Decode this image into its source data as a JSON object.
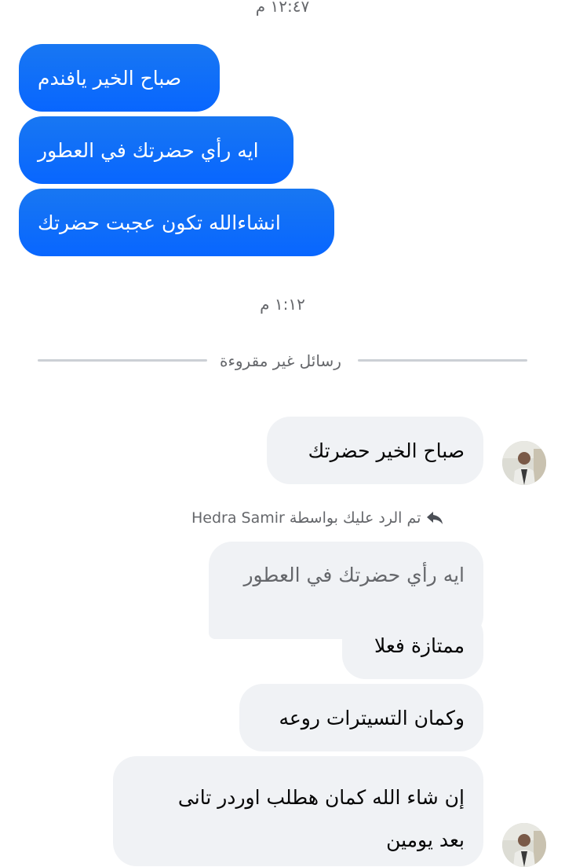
{
  "timestamps": {
    "first": "١٢:٤٧ م",
    "second": "١:١٢ م"
  },
  "outgoing": [
    "صباح الخير يافندم",
    "ايه رأي حضرتك في العطور",
    "انشاءالله تكون عجبت حضرتك"
  ],
  "unread_divider": "رسائل غير مقروءة",
  "incoming_first": "صباح الخير حضرتك",
  "reply_notice": "تم الرد عليك بواسطة Hedra Samir",
  "quoted_message": "ايه رأي حضرتك في العطور",
  "incoming": [
    "ممتازة فعلا",
    "وكمان التسيترات روعه"
  ],
  "incoming_last": {
    "line1": "إن شاء الله كمان هطلب اوردر تانى",
    "line2": "بعد يومين"
  },
  "icons": {
    "reply": "reply-arrow-icon",
    "avatar": "contact-avatar"
  },
  "colors": {
    "outgoing_bubble": "#0866ff",
    "incoming_bubble": "#f0f2f5",
    "secondary_text": "#65676b"
  }
}
